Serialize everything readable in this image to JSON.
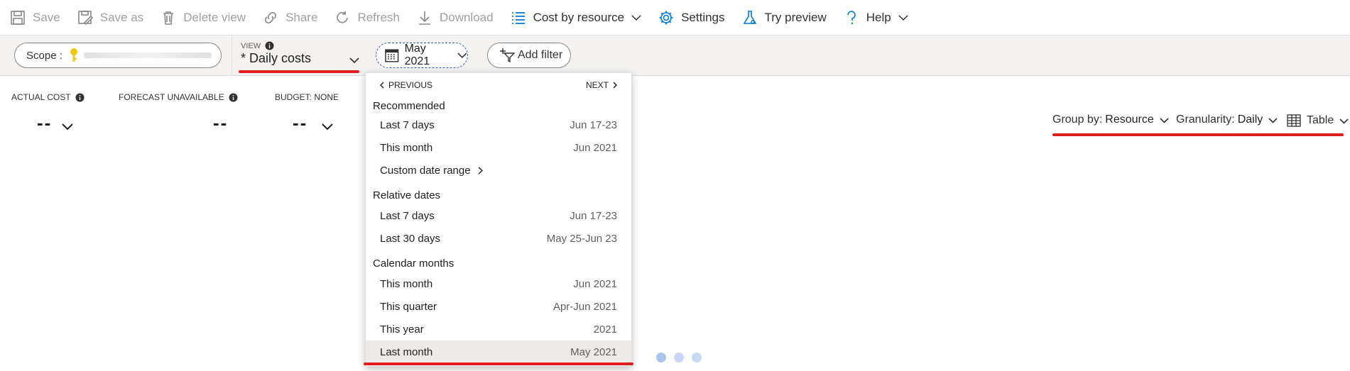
{
  "toolbar": {
    "save": "Save",
    "save_as": "Save as",
    "delete_view": "Delete view",
    "share": "Share",
    "refresh": "Refresh",
    "download": "Download",
    "cost_by_resource": "Cost by resource",
    "settings": "Settings",
    "try_preview": "Try preview",
    "help": "Help"
  },
  "filterbar": {
    "scope_label": "Scope :",
    "view_label": "VIEW",
    "view_value": "* Daily costs",
    "date_value": "May 2021",
    "add_filter": "Add filter"
  },
  "kpis": {
    "actual_cost_label": "ACTUAL COST",
    "actual_cost_value": "--",
    "forecast_label": "FORECAST UNAVAILABLE",
    "forecast_value": "--",
    "budget_label": "BUDGET: NONE",
    "budget_value": "--"
  },
  "controls": {
    "group_by_label": "Group by:",
    "group_by_value": "Resource",
    "granularity_label": "Granularity:",
    "granularity_value": "Daily",
    "chart_type": "Table"
  },
  "date_menu": {
    "previous": "PREVIOUS",
    "next": "NEXT",
    "sections": [
      {
        "title": "Recommended",
        "items": [
          {
            "label": "Last 7 days",
            "value": "Jun 17-23"
          },
          {
            "label": "This month",
            "value": "Jun 2021"
          },
          {
            "label": "Custom date range",
            "value": ""
          }
        ]
      },
      {
        "title": "Relative dates",
        "items": [
          {
            "label": "Last 7 days",
            "value": "Jun 17-23"
          },
          {
            "label": "Last 30 days",
            "value": "May 25-Jun 23"
          }
        ]
      },
      {
        "title": "Calendar months",
        "items": [
          {
            "label": "This month",
            "value": "Jun 2021"
          },
          {
            "label": "This quarter",
            "value": "Apr-Jun 2021"
          },
          {
            "label": "This year",
            "value": "2021"
          },
          {
            "label": "Last month",
            "value": "May 2021"
          }
        ]
      }
    ]
  },
  "colors": {
    "accent": "#0078d4",
    "highlight_underline": "#e01e1e",
    "loading_dot": "#a9c4ee"
  }
}
